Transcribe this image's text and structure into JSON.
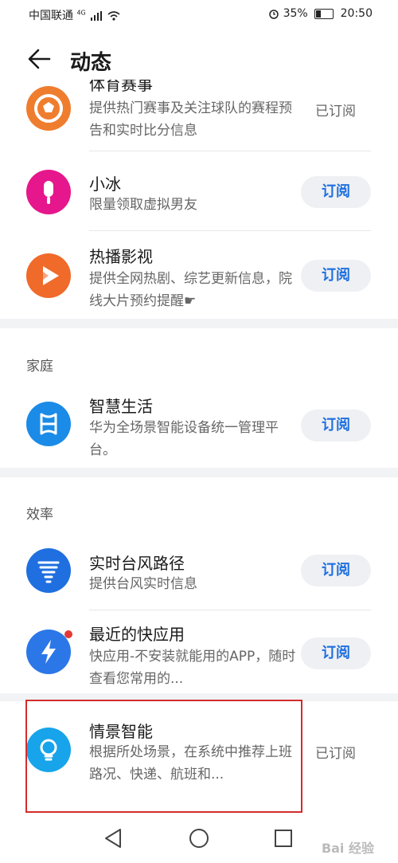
{
  "status_bar": {
    "carrier": "中国联通",
    "network": "4G",
    "battery": "35%",
    "time": "20:50"
  },
  "header": {
    "title": "动态"
  },
  "items_top": [
    {
      "name": "体育赛事",
      "desc": "提供热门赛事及关注球队的赛程预告和实时比分信息",
      "action": "已订阅",
      "icon": "trophy-icon",
      "color": "#ef7d2e"
    },
    {
      "name": "小冰",
      "desc": "限量领取虚拟男友",
      "action": "订阅",
      "icon": "popsicle-icon",
      "color": "#e6168c"
    },
    {
      "name": "热播影视",
      "desc": "提供全网热剧、综艺更新信息，院线大片预约提醒☛",
      "action": "订阅",
      "icon": "play-icon",
      "color": "#f06a2a"
    }
  ],
  "section_home": {
    "label": "家庭"
  },
  "items_home": [
    {
      "name": "智慧生活",
      "desc": "华为全场景智能设备统一管理平台。",
      "action": "订阅",
      "icon": "smart-home-icon",
      "color": "#1b8be8"
    }
  ],
  "section_efficiency": {
    "label": "效率"
  },
  "items_efficiency": [
    {
      "name": "实时台风路径",
      "desc": "提供台风实时信息",
      "action": "订阅",
      "icon": "typhoon-icon",
      "color": "#1f6fe0"
    },
    {
      "name": "最近的快应用",
      "desc": "快应用-不安装就能用的APP，随时查看您常用的...",
      "action": "订阅",
      "icon": "lightning-icon",
      "color": "#2b77e8"
    },
    {
      "name": "情景智能",
      "desc": "根据所处场景，在系统中推荐上班路况、快递、航班和...",
      "action": "已订阅",
      "icon": "bulb-icon",
      "color": "#17a4ea"
    }
  ],
  "watermark": "Bai 经验"
}
